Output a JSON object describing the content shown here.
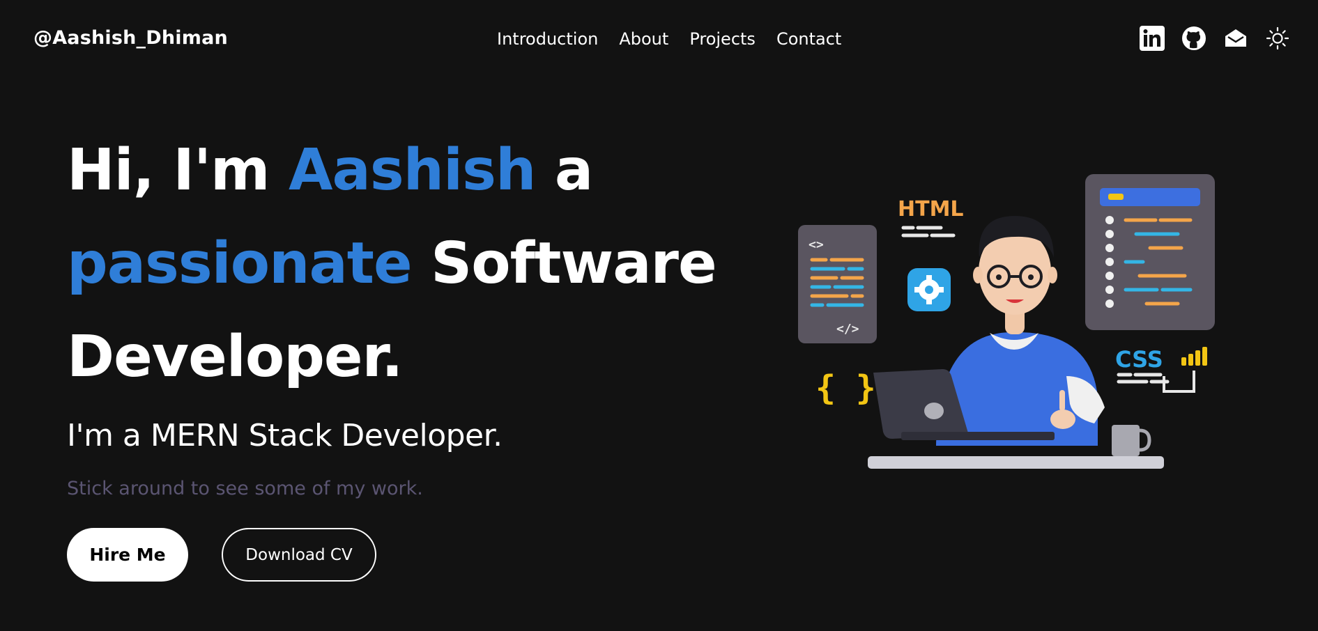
{
  "header": {
    "brand": "@Aashish_Dhiman",
    "nav": [
      {
        "label": "Introduction"
      },
      {
        "label": "About"
      },
      {
        "label": "Projects"
      },
      {
        "label": "Contact"
      }
    ],
    "icons": [
      "linkedin-icon",
      "github-icon",
      "mail-icon",
      "theme-toggle-icon"
    ]
  },
  "hero": {
    "line1_prefix": "Hi, I'm ",
    "line1_highlight": "Aashish",
    "line1_suffix": " a",
    "line2_highlight": "passionate",
    "line2_suffix": " Software",
    "line3": "Developer.",
    "subtitle": "I'm a MERN Stack Developer.",
    "tagline": "Stick around to see some of my work.",
    "hire_label": "Hire Me",
    "cv_label": "Download CV"
  },
  "illustration": {
    "html_label": "HTML",
    "css_label": "CSS",
    "code_open": "<>",
    "code_close": "</>",
    "braces": "{ }"
  },
  "colors": {
    "background": "#121212",
    "accent": "#2f7ed8",
    "muted": "#5b5572"
  }
}
